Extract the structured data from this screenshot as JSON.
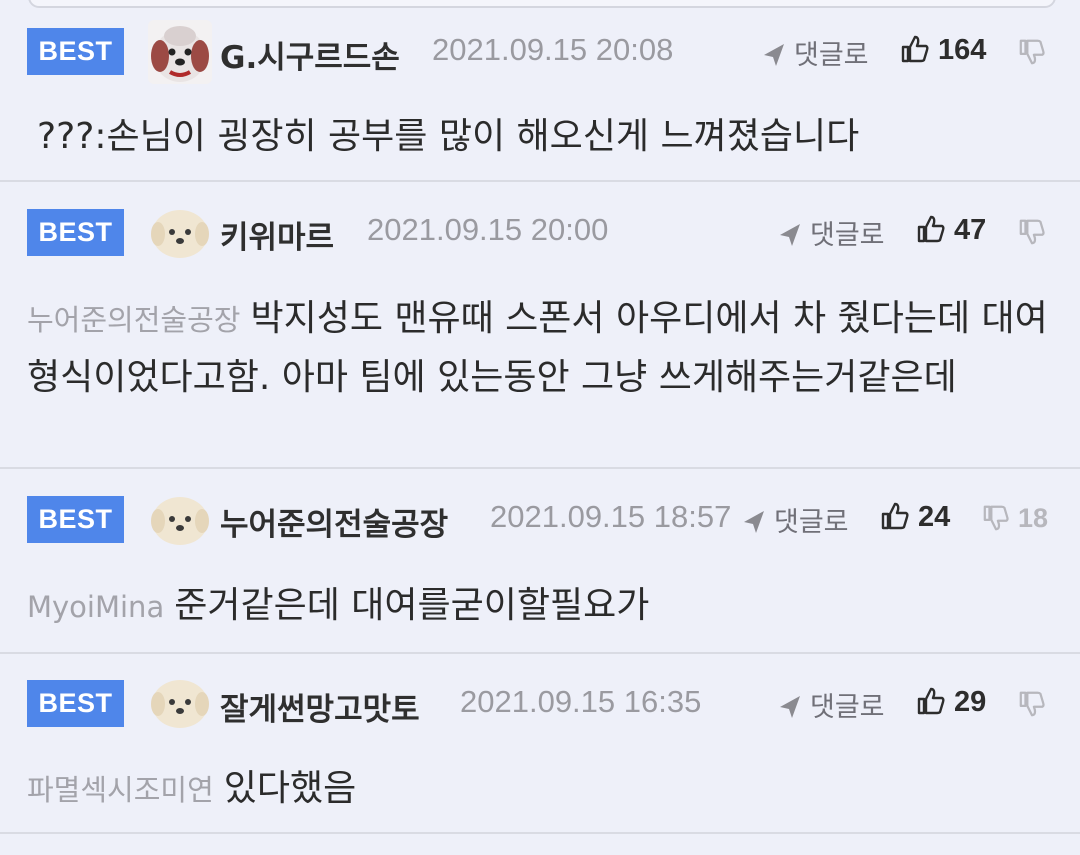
{
  "labels": {
    "best": "BEST",
    "reply": "댓글로"
  },
  "comments": [
    {
      "nickname": "G.시구르드손",
      "datetime": "2021.09.15 20:08",
      "likes": "164",
      "dislikes": "",
      "mention": "",
      "text": "???:손님이 굉장히 공부를 많이 해오신게 느껴졌습니다"
    },
    {
      "nickname": "키위마르",
      "datetime": "2021.09.15 20:00",
      "likes": "47",
      "dislikes": "",
      "mention": "누어준의전술공장",
      "text": "박지성도 맨유때 스폰서 아우디에서 차 줬다는데 대여형식이었다고함. 아마 팀에 있는동안 그냥 쓰게해주는거같은데"
    },
    {
      "nickname": "누어준의전술공장",
      "datetime": "2021.09.15 18:57",
      "likes": "24",
      "dislikes": "18",
      "mention": "MyoiMina",
      "text": "준거같은데 대여를굳이할필요가"
    },
    {
      "nickname": "잘게썬망고맛토",
      "datetime": "2021.09.15 16:35",
      "likes": "29",
      "dislikes": "",
      "mention": "파멸섹시조미연",
      "text": "있다했음"
    }
  ],
  "icons": {
    "reply": "reply-arrow-icon",
    "like": "thumbs-up-icon",
    "dislike": "thumbs-down-icon"
  },
  "colors": {
    "background": "#eef0f9",
    "best_badge": "#4f86ea",
    "divider": "#d9dbe3",
    "muted_text": "#9a9aa0"
  }
}
